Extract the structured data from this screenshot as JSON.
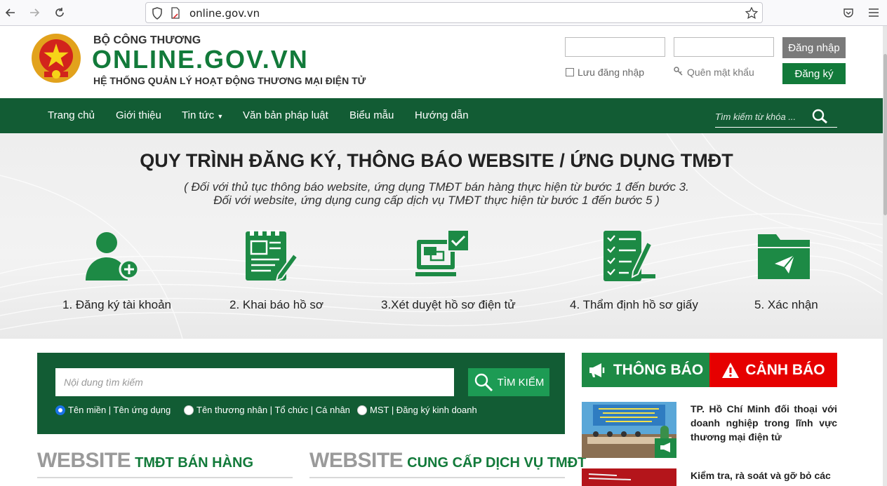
{
  "browser": {
    "url": "online.gov.vn",
    "icons": [
      "back-arrow-icon",
      "forward-arrow-icon",
      "reload-icon",
      "shield-icon",
      "page-icon",
      "star-icon",
      "pocket-icon",
      "menu-icon"
    ]
  },
  "header": {
    "ministry": "BỘ CÔNG THƯƠNG",
    "title": "ONLINE.GOV.VN",
    "subtitle": "HỆ THỐNG QUẢN LÝ HOẠT ĐỘNG THƯƠNG MẠI ĐIỆN TỬ",
    "login_label": "Đăng nhập",
    "register_label": "Đăng ký",
    "remember_label": "Lưu đăng nhập",
    "forgot_label": "Quên mật khẩu"
  },
  "nav": {
    "items": [
      {
        "label": "Trang chủ"
      },
      {
        "label": "Giới thiệu"
      },
      {
        "label": "Tin tức"
      },
      {
        "label": "Văn bản pháp luật"
      },
      {
        "label": "Biểu mẫu"
      },
      {
        "label": "Hướng dẫn"
      }
    ],
    "search_placeholder": "Tìm kiếm từ khóa ..."
  },
  "process": {
    "title": "QUY TRÌNH ĐĂNG KÝ, THÔNG BÁO WEBSITE / ỨNG DỤNG TMĐT",
    "note_line1": "( Đối với thủ tục thông báo website, ứng dụng TMĐT bán hàng thực hiện từ bước 1 đến bước 3.",
    "note_line2": "Đối với website, ứng dụng cung cấp dịch vụ TMĐT thực hiện từ bước 1 đến bước 5 )",
    "steps": [
      {
        "label": "1. Đăng ký tài khoản",
        "icon": "user-add-icon"
      },
      {
        "label": "2. Khai báo hồ sơ",
        "icon": "document-edit-icon"
      },
      {
        "label": "3.Xét duyệt hồ sơ điện tử",
        "icon": "monitor-check-icon"
      },
      {
        "label": "4. Thẩm định hồ sơ giấy",
        "icon": "checklist-pen-icon"
      },
      {
        "label": "5. Xác nhận",
        "icon": "folder-send-icon"
      }
    ]
  },
  "search": {
    "placeholder": "Nội dung tìm kiếm",
    "button_label": "TÌM KIẾM",
    "options": [
      {
        "label": "Tên miền | Tên ứng dụng",
        "selected": true
      },
      {
        "label": "Tên thương nhân | Tổ chức | Cá nhân",
        "selected": false
      },
      {
        "label": "MST | Đăng ký kinh doanh",
        "selected": false
      }
    ]
  },
  "sections": {
    "sales_big": "WEBSITE",
    "sales_small": "TMĐT BÁN HÀNG",
    "service_big": "WEBSITE",
    "service_small": "CUNG CẤP DỊCH VỤ TMĐT"
  },
  "notices": {
    "tab_notice": "THÔNG BÁO",
    "tab_warning": "CẢNH BÁO",
    "items": [
      {
        "text": "TP. Hồ Chí Minh đối thoại với doanh nghiệp trong lĩnh vực thương mại điện tử"
      },
      {
        "text": "Kiểm tra, rà soát và gỡ bỏ các"
      }
    ]
  },
  "colors": {
    "brand_green": "#125c34",
    "accent_green": "#1d8a45",
    "warning_red": "#e60000"
  }
}
